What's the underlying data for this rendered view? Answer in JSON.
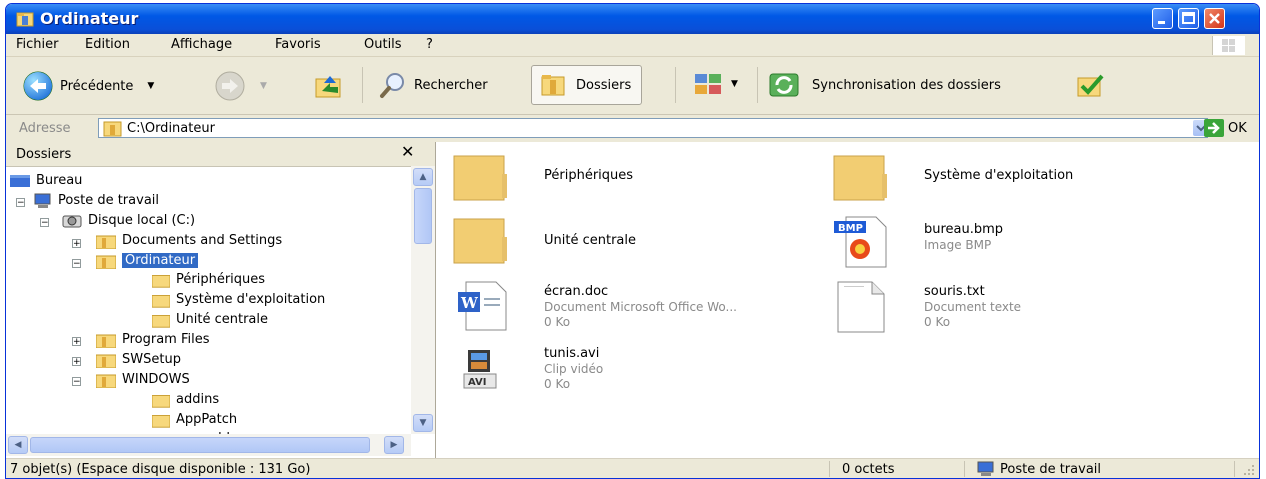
{
  "window": {
    "title": "Ordinateur"
  },
  "menu": [
    "Fichier",
    "Edition",
    "Affichage",
    "Favoris",
    "Outils",
    "?"
  ],
  "toolbar": {
    "back_label": "Précédente",
    "search_label": "Rechercher",
    "folders_label": "Dossiers",
    "sync_label": "Synchronisation des dossiers"
  },
  "address": {
    "label": "Adresse",
    "value": "C:\\Ordinateur",
    "go_label": "OK"
  },
  "tree": {
    "title": "Dossiers",
    "nodes": [
      {
        "label": "Bureau"
      },
      {
        "label": "Poste de travail"
      },
      {
        "label": "Disque local (C:)"
      },
      {
        "label": "Documents and Settings"
      },
      {
        "label": "Ordinateur"
      },
      {
        "label": "Périphériques"
      },
      {
        "label": "Système d'exploitation"
      },
      {
        "label": "Unité centrale"
      },
      {
        "label": "Program Files"
      },
      {
        "label": "SWSetup"
      },
      {
        "label": "WINDOWS"
      },
      {
        "label": "addins"
      },
      {
        "label": "AppPatch"
      },
      {
        "label": "assembly"
      }
    ]
  },
  "files": [
    {
      "name": "Périphériques"
    },
    {
      "name": "Système d'exploitation"
    },
    {
      "name": "Unité centrale"
    },
    {
      "name": "bureau.bmp",
      "type": "Image BMP"
    },
    {
      "name": "écran.doc",
      "type": "Document Microsoft Office Wo...",
      "size": "0 Ko"
    },
    {
      "name": "souris.txt",
      "type": "Document texte",
      "size": "0 Ko"
    },
    {
      "name": "tunis.avi",
      "type": "Clip vidéo",
      "size": "0 Ko"
    }
  ],
  "status": {
    "objects": "7 objet(s) (Espace disque disponible : 131 Go)",
    "size": "0 octets",
    "location": "Poste de travail"
  },
  "colors": {
    "titlebar": "#0058e6",
    "selection": "#316ac5",
    "chrome": "#ece9d8"
  }
}
